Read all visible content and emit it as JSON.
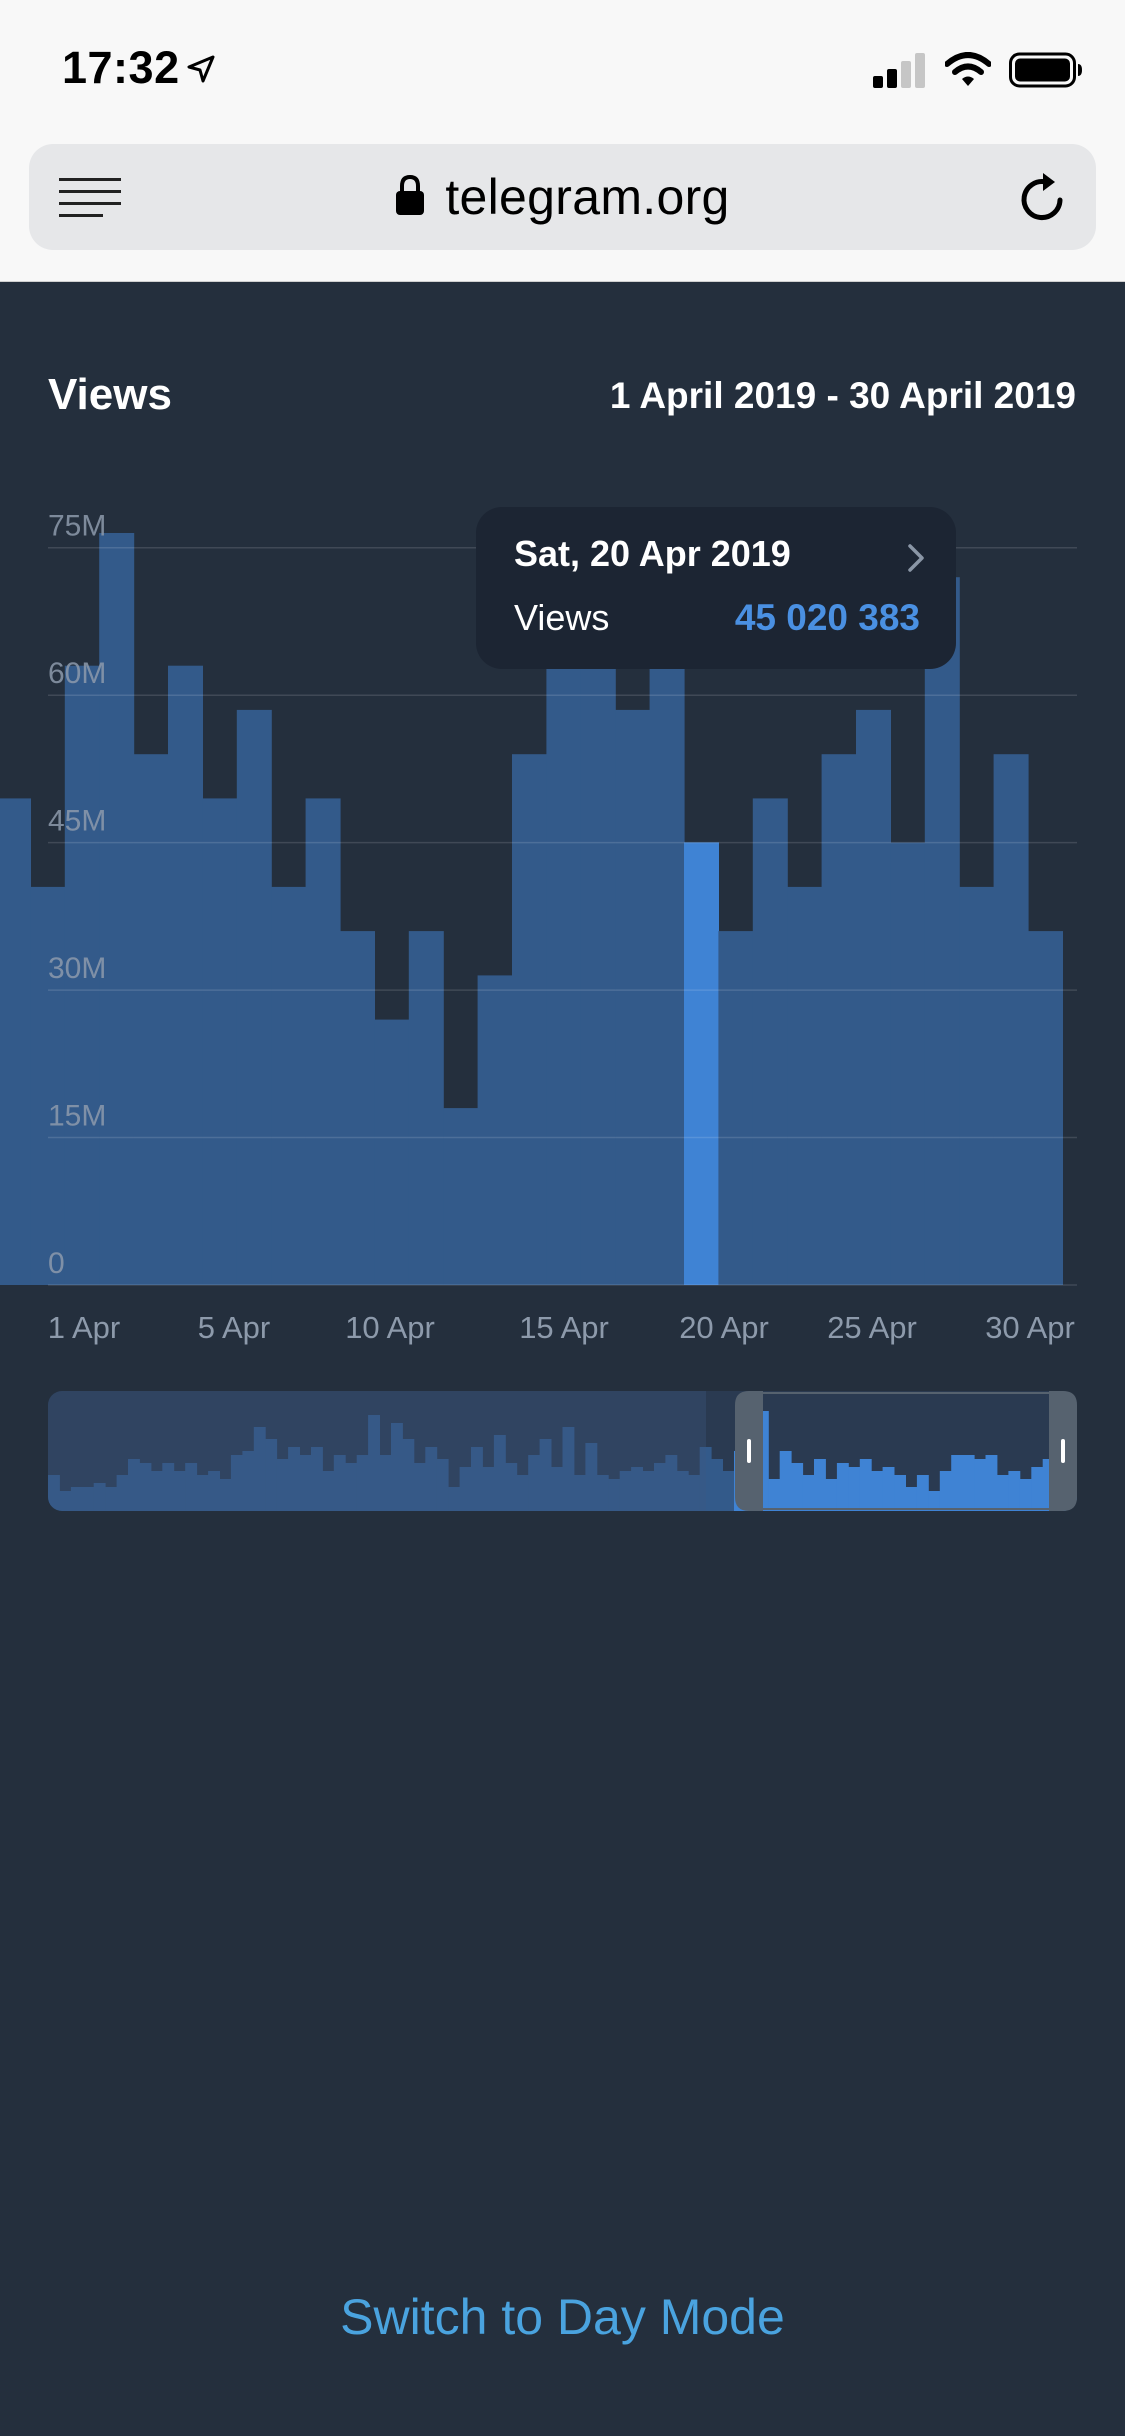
{
  "status_bar": {
    "time": "17:32",
    "icons": [
      "location-arrow-icon",
      "cellular-signal-icon",
      "wifi-icon",
      "battery-icon"
    ]
  },
  "browser": {
    "url": "telegram.org",
    "icons": [
      "menu-icon",
      "lock-icon",
      "reload-icon"
    ]
  },
  "chart_header": {
    "title": "Views",
    "range": "1 April 2019 - 30 April 2019"
  },
  "tooltip": {
    "date": "Sat, 20 Apr 2019",
    "label": "Views",
    "value": "45 020 383"
  },
  "footer": {
    "switch_label": "Switch to Day Mode"
  },
  "colors": {
    "background": "#242f3d",
    "bar": "#335a8a",
    "bar_highlight": "#3f83d4",
    "accent": "#4aa3df"
  },
  "chart_data": {
    "type": "bar",
    "x_tick_labels": [
      "1 Apr",
      "5 Apr",
      "10 Apr",
      "15 Apr",
      "20 Apr",
      "25 Apr",
      "30 Apr"
    ],
    "y_tick_labels": [
      "0",
      "15M",
      "30M",
      "45M",
      "60M",
      "75M"
    ],
    "ylim": [
      0,
      76500000
    ],
    "highlighted_x": "20 Apr",
    "series": [
      {
        "x": [
          "31 Mar",
          "1 Apr",
          "2 Apr",
          "3 Apr",
          "4 Apr",
          "5 Apr",
          "6 Apr",
          "7 Apr",
          "8 Apr",
          "9 Apr",
          "10 Apr",
          "11 Apr",
          "12 Apr",
          "13 Apr",
          "14 Apr",
          "15 Apr",
          "16 Apr",
          "17 Apr",
          "18 Apr",
          "19 Apr",
          "20 Apr",
          "21 Apr",
          "22 Apr",
          "23 Apr",
          "24 Apr",
          "25 Apr",
          "26 Apr",
          "27 Apr",
          "28 Apr",
          "29 Apr",
          "30 Apr"
        ],
        "values": [
          49500000,
          40500000,
          63000000,
          76500000,
          54000000,
          63000000,
          49500000,
          58500000,
          40500000,
          49500000,
          36000000,
          27000000,
          36000000,
          18000000,
          31500000,
          54000000,
          63000000,
          67500000,
          58500000,
          63000000,
          45020383,
          36000000,
          49500000,
          40500000,
          54000000,
          58500000,
          45000000,
          72000000,
          40500000,
          54000000,
          36000000
        ]
      }
    ],
    "navigator": {
      "days": 90,
      "selected_from": "1 Apr",
      "selected_to": "30 Apr",
      "values": [
        9000000,
        5000000,
        6000000,
        6000000,
        7000000,
        6000000,
        9000000,
        13000000,
        12000000,
        10000000,
        12000000,
        10000000,
        12000000,
        9000000,
        10000000,
        8000000,
        14000000,
        15000000,
        21000000,
        18000000,
        13000000,
        16000000,
        14000000,
        16000000,
        10000000,
        14000000,
        12000000,
        14000000,
        24000000,
        14000000,
        22000000,
        18000000,
        12000000,
        16000000,
        13000000,
        6000000,
        11000000,
        16000000,
        11000000,
        19000000,
        12000000,
        9000000,
        14000000,
        18000000,
        11000000,
        21000000,
        9000000,
        17000000,
        9000000,
        8000000,
        10000000,
        11000000,
        10000000,
        12000000,
        14000000,
        10000000,
        9000000,
        16000000,
        13000000,
        10000000,
        15000000,
        9000000,
        25000000,
        8000000,
        15000000,
        12000000,
        9000000,
        13000000,
        8000000,
        12000000,
        11000000,
        13000000,
        10000000,
        11000000,
        9000000,
        6000000,
        9000000,
        5000000,
        10000000,
        14000000,
        14000000,
        13000000,
        14000000,
        9000000,
        10000000,
        8000000,
        11000000,
        13000000,
        10000000,
        15000000
      ]
    }
  }
}
